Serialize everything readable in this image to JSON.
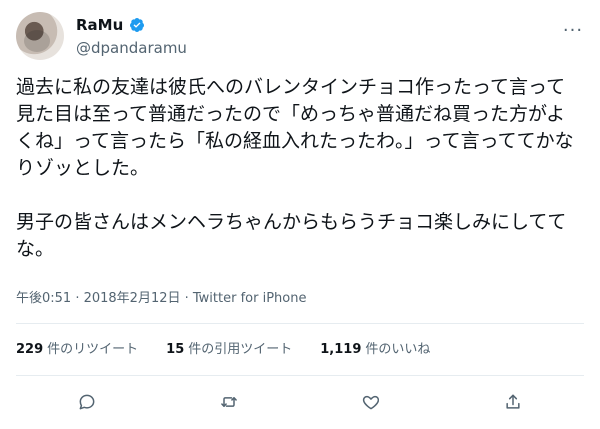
{
  "author": {
    "name": "RaMu",
    "handle": "@dpandaramu"
  },
  "more_menu_label": "···",
  "tweet_text": "過去に私の友達は彼氏へのバレンタインチョコ作ったって言って見た目は至って普通だったので「めっちゃ普通だね買った方がよくね」って言ったら「私の経血入れたったわ。」って言っててかなりゾッとした。\n\n男子の皆さんはメンヘラちゃんからもらうチョコ楽しみにしててな。",
  "meta": {
    "timestamp": "午後0:51 · 2018年2月12日 · Twitter for iPhone"
  },
  "stats": {
    "retweets": {
      "count": "229",
      "label": "件のリツイート"
    },
    "quotes": {
      "count": "15",
      "label": "件の引用ツイート"
    },
    "likes": {
      "count": "1,119",
      "label": "件のいいね"
    }
  },
  "colors": {
    "verified": "#1d9bf0",
    "text": "#0f1419",
    "secondary": "#536471",
    "divider": "#e6ecf0"
  },
  "icons": {
    "reply": "speech-bubble",
    "retweet": "retweet-arrows",
    "like": "heart-outline",
    "share": "share-upload"
  }
}
